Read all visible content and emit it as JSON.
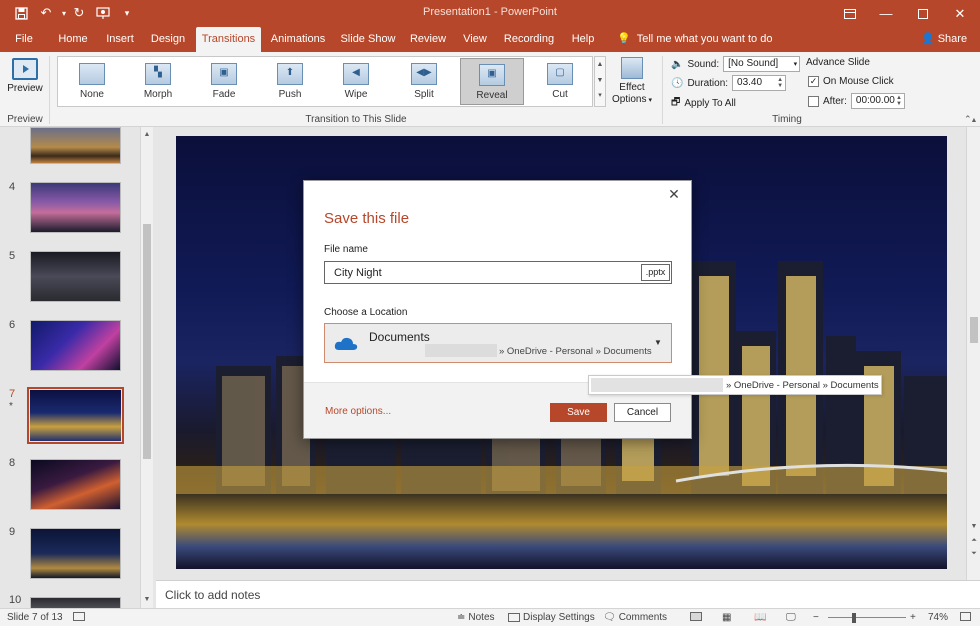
{
  "titlebar": {
    "title": "Presentation1 - PowerPoint",
    "bg_color": "#b7472a",
    "quick_access_icons": [
      "save-icon",
      "undo-icon",
      "redo-icon",
      "presenter-icon",
      "customize-icon"
    ],
    "window_icons": [
      "ribbon-display-icon",
      "minimize-icon",
      "maximize-icon",
      "close-icon"
    ]
  },
  "tabs": [
    "File",
    "Home",
    "Insert",
    "Design",
    "Transitions",
    "Animations",
    "Slide Show",
    "Review",
    "View",
    "Recording",
    "Help"
  ],
  "active_tab": "Transitions",
  "tell_me": "Tell me what you want to do",
  "share": "Share",
  "ribbon": {
    "preview_label": "Preview",
    "preview_group": "Preview",
    "transitions_group": "Transition to This Slide",
    "transitions": [
      "None",
      "Morph",
      "Fade",
      "Push",
      "Wipe",
      "Split",
      "Reveal",
      "Cut"
    ],
    "selected_transition": "Reveal",
    "effect_options": "Effect",
    "effect_options2": "Options",
    "sound_label": "Sound:",
    "sound_value": "[No Sound]",
    "duration_label": "Duration:",
    "duration_value": "03.40",
    "apply_all": "Apply To All",
    "advance_label": "Advance Slide",
    "on_mouse_click": "On Mouse Click",
    "on_mouse_click_checked": true,
    "after_label": "After:",
    "after_value": "00:00.00",
    "timing_group": "Timing"
  },
  "slides": [
    {
      "num": "",
      "theme": "sunset-city"
    },
    {
      "num": "4",
      "theme": "purple-skyline"
    },
    {
      "num": "5",
      "theme": "grey-night"
    },
    {
      "num": "6",
      "theme": "pink-neon"
    },
    {
      "num": "7",
      "theme": "city-night",
      "active": true,
      "star": "*"
    },
    {
      "num": "8",
      "theme": "light-trails"
    },
    {
      "num": "9",
      "theme": "blue-towers"
    },
    {
      "num": "10",
      "theme": "grey-partial"
    }
  ],
  "notes_placeholder": "Click to add notes",
  "status": {
    "slide_of": "Slide 7 of 13",
    "notes": "Notes",
    "display_settings": "Display Settings",
    "comments": "Comments",
    "zoom": "74%"
  },
  "dialog": {
    "title": "Save this file",
    "file_name_label": "File name",
    "file_name_value": "City Night",
    "extension": ".pptx",
    "location_label": "Choose a Location",
    "location_name": "Documents",
    "location_path": "» OneDrive - Personal » Documents",
    "more_options": "More options...",
    "save": "Save",
    "cancel": "Cancel"
  },
  "tooltip": {
    "text": "» OneDrive - Personal » Documents"
  }
}
